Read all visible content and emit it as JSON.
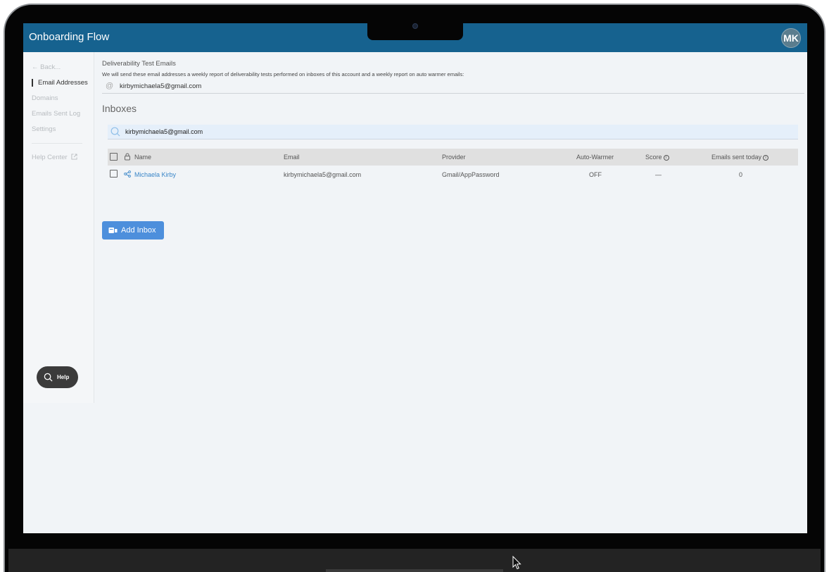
{
  "header": {
    "title": "Onboarding Flow",
    "avatar_initials": "MK",
    "accent_color": "#16628f"
  },
  "sidebar": {
    "back_label": "Back...",
    "items": [
      {
        "label": "Email Addresses",
        "active": true
      },
      {
        "label": "Domains",
        "active": false
      },
      {
        "label": "Emails Sent Log",
        "active": false
      },
      {
        "label": "Settings",
        "active": false
      }
    ],
    "help_center_label": "Help Center",
    "help_button_label": "Help"
  },
  "deliverability": {
    "label": "Deliverability Test Emails",
    "description": "We will send these email addresses a weekly report of deliverability tests performed on inboxes of this account and a weekly report on auto warmer emails:",
    "email": "kirbymichaela5@gmail.com"
  },
  "inboxes": {
    "title": "Inboxes",
    "search_value": "kirbymichaela5@gmail.com",
    "columns": [
      "Name",
      "Email",
      "Provider",
      "Auto-Warmer",
      "Score",
      "Emails sent today"
    ],
    "rows": [
      {
        "name": "Michaela Kirby",
        "email": "kirbymichaela5@gmail.com",
        "provider": "Gmail/AppPassword",
        "auto_warmer": "OFF",
        "score": "—",
        "emails_sent_today": "0"
      }
    ],
    "add_button_label": "Add Inbox",
    "add_button_color": "#4d8fdc"
  }
}
